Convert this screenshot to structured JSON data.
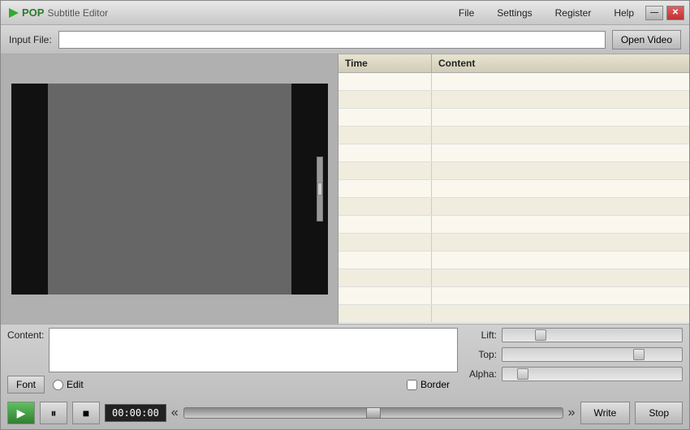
{
  "app": {
    "title": "POP Subtitle Editor",
    "pop_label": "POP",
    "subtitle_editor_label": "Subtitle Editor"
  },
  "titlebar": {
    "minimize_label": "—",
    "close_label": "✕"
  },
  "menubar": {
    "items": [
      {
        "label": "File",
        "id": "file"
      },
      {
        "label": "Settings",
        "id": "settings"
      },
      {
        "label": "Register",
        "id": "register"
      },
      {
        "label": "Help",
        "id": "help"
      }
    ]
  },
  "inputfile": {
    "label": "Input File:",
    "placeholder": "",
    "open_video_label": "Open Video"
  },
  "subtitle_table": {
    "columns": [
      {
        "label": "Time",
        "id": "time"
      },
      {
        "label": "Content",
        "id": "content"
      }
    ],
    "rows": [
      {},
      {},
      {},
      {},
      {},
      {},
      {},
      {},
      {},
      {},
      {},
      {},
      {},
      {}
    ]
  },
  "bottom": {
    "content_label": "Content:",
    "font_label": "Font",
    "edit_label": "Edit",
    "border_label": "Border",
    "lift_label": "Lift:",
    "top_label": "Top:",
    "alpha_label": "Alpha:",
    "lift_thumb_pct": 20,
    "top_thumb_pct": 75,
    "alpha_thumb_pct": 10
  },
  "transport": {
    "time_display": "00:00:00",
    "play_icon": "▶",
    "pause_icon": "⏸",
    "stop_icon": "■",
    "prev_icon": "«",
    "next_icon": "»",
    "write_label": "Write",
    "stop_label": "Stop"
  }
}
